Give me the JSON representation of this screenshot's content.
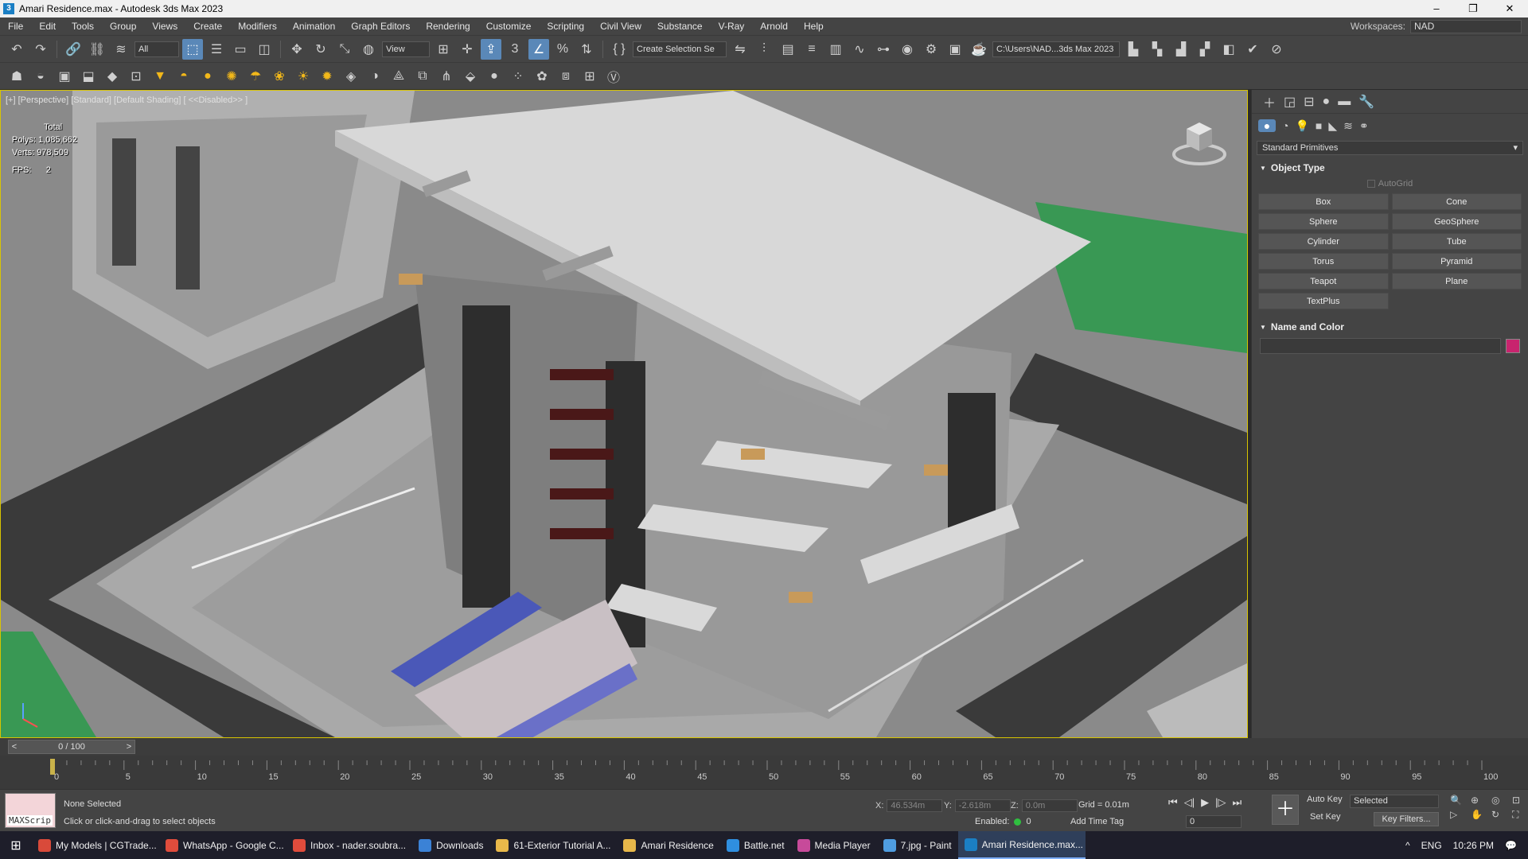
{
  "window": {
    "title": "Amari Residence.max - Autodesk 3ds Max 2023",
    "min": "–",
    "max": "❐",
    "close": "✕"
  },
  "menu": [
    "File",
    "Edit",
    "Tools",
    "Group",
    "Views",
    "Create",
    "Modifiers",
    "Animation",
    "Graph Editors",
    "Rendering",
    "Customize",
    "Scripting",
    "Civil View",
    "Substance",
    "V-Ray",
    "Arnold",
    "Help"
  ],
  "workspace": {
    "label": "Workspaces:",
    "value": "NAD"
  },
  "toolbar1": {
    "filter": "All",
    "refcoord": "View",
    "selset": "Create Selection Se",
    "path": "C:\\Users\\NAD...3ds Max 2023"
  },
  "viewport": {
    "label": "[+] [Perspective] [Standard] [Default Shading] [ <<Disabled>> ]",
    "stats": {
      "total": "Total",
      "polys_label": "Polys:",
      "polys": "1,085,662",
      "verts_label": "Verts:",
      "verts": "978,509",
      "fps_label": "FPS:",
      "fps": "2"
    }
  },
  "cmdpanel": {
    "dropdown": "Standard Primitives",
    "object_type": "Object Type",
    "autogrid": "AutoGrid",
    "buttons": [
      "Box",
      "Cone",
      "Sphere",
      "GeoSphere",
      "Cylinder",
      "Tube",
      "Torus",
      "Pyramid",
      "Teapot",
      "Plane",
      "TextPlus"
    ],
    "name_color": "Name and Color"
  },
  "timeslider": {
    "value": "0 / 100",
    "prev": "<",
    "next": ">"
  },
  "track": {
    "ticks": [
      "0",
      "5",
      "10",
      "15",
      "20",
      "25",
      "30",
      "35",
      "40",
      "45",
      "50",
      "55",
      "60",
      "65",
      "70",
      "75",
      "80",
      "85",
      "90",
      "95",
      "100"
    ]
  },
  "status": {
    "maxscript": "MAXScrip",
    "selection": "None Selected",
    "prompt": "Click or click-and-drag to select objects",
    "x_label": "X:",
    "x": "46.534m",
    "y_label": "Y:",
    "y": "-2.618m",
    "z_label": "Z:",
    "z": "0.0m",
    "grid": "Grid = 0.01m",
    "enabled": "Enabled:",
    "enabled_val": "0",
    "add_time_tag": "Add Time Tag",
    "frame": "0",
    "auto_key": "Auto Key",
    "set_key": "Set Key",
    "selected": "Selected",
    "key_filters": "Key Filters..."
  },
  "taskbar": {
    "items": [
      {
        "label": "My Models | CGTrade...",
        "color": "#d94a3a"
      },
      {
        "label": "WhatsApp - Google C...",
        "color": "#e04c3c"
      },
      {
        "label": "Inbox - nader.soubra...",
        "color": "#e04c3c"
      },
      {
        "label": "Downloads",
        "color": "#3b82d6"
      },
      {
        "label": "61-Exterior Tutorial A...",
        "color": "#e8b84a"
      },
      {
        "label": "Amari Residence",
        "color": "#e8b84a"
      },
      {
        "label": "Battle.net",
        "color": "#2f8fe0"
      },
      {
        "label": "Media Player",
        "color": "#c74a9a"
      },
      {
        "label": "7.jpg - Paint",
        "color": "#4f9de0"
      },
      {
        "label": "Amari Residence.max...",
        "color": "#1b7fc4"
      }
    ],
    "lang": "ENG",
    "time": "10:26 PM"
  }
}
